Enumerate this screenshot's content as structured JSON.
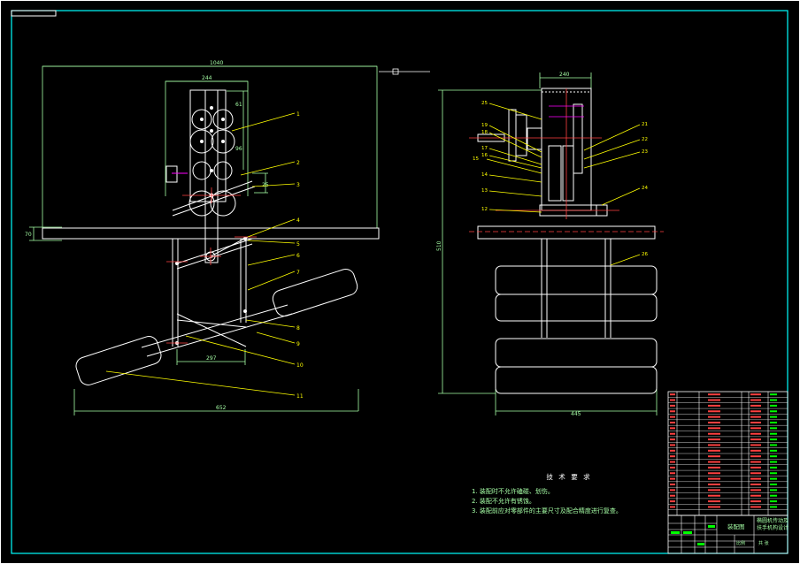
{
  "front_view": {
    "dims": {
      "overall_width": "1040",
      "top_width": "244",
      "left_height": "70",
      "bottom_width": "652",
      "foot_spacing": "297",
      "side_small": "25",
      "top_small": "61",
      "mid_small": "96"
    },
    "balloons": [
      "1",
      "2",
      "3",
      "4",
      "5",
      "6",
      "7",
      "8",
      "9",
      "10",
      "11"
    ]
  },
  "side_view": {
    "dims": {
      "top_width": "240",
      "height": "510",
      "bottom_width": "445"
    },
    "balloons": [
      "25",
      "19",
      "18",
      "17",
      "16",
      "15",
      "14",
      "13",
      "12",
      "21",
      "22",
      "23",
      "24",
      "26"
    ]
  },
  "tech_notes": {
    "title": "技 术 要 求",
    "lines": [
      "1. 装配时不允许磕碰、划伤。",
      "2. 装配不允许有锈蚀。",
      "3. 装配前应对零部件的主要尺寸及配合精度进行复查。"
    ]
  },
  "title_block": {
    "drawing_name": "装配图",
    "project_name": "椭圆机传动及扶手机构设计",
    "sheet_label": "共 张",
    "scale_label": "比例"
  },
  "colors": {
    "frame": "#00ffff",
    "geometry": "#ffffff",
    "leaders": "#ffff00",
    "dimensions": "#a6ffa6",
    "center": "#ff4040",
    "hidden": "#ff00ff"
  }
}
